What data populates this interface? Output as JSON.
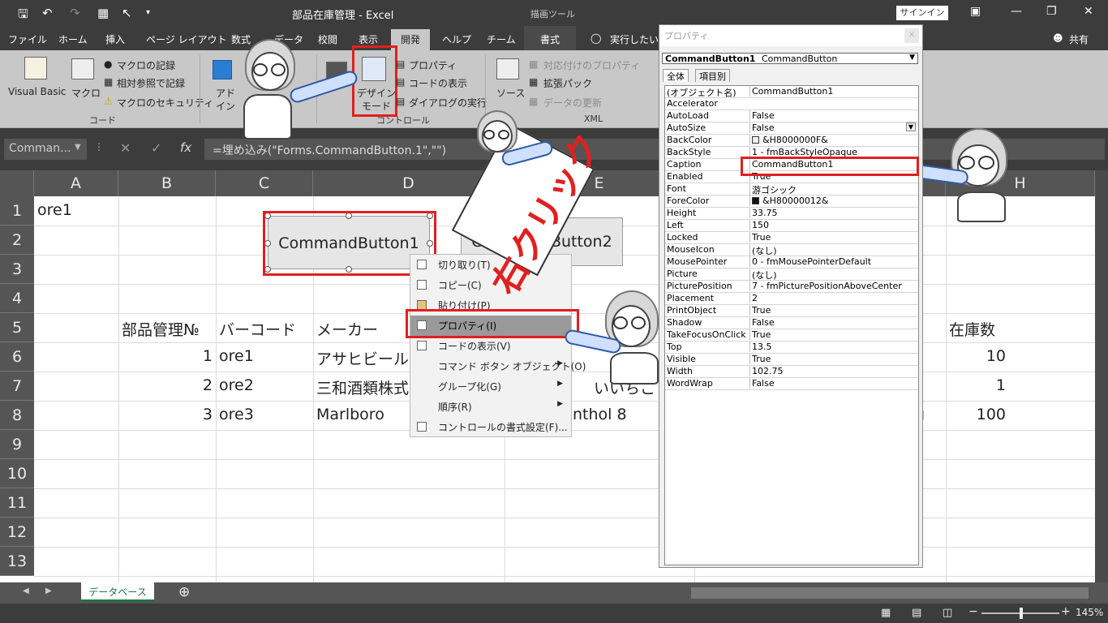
{
  "window": {
    "title": "部品在庫管理 - Excel",
    "drawing_tools": "描画ツール",
    "signin": "サインイン"
  },
  "tabs": [
    "ファイル",
    "ホーム",
    "挿入",
    "ページ レイアウト",
    "数式",
    "データ",
    "校閲",
    "表示",
    "開発",
    "ヘルプ",
    "チーム",
    "書式",
    "実行したい作業を入力してください",
    "共有"
  ],
  "ribbon": {
    "visual_basic": "Visual Basic",
    "macro": "マクロ",
    "macro_record": "マクロの記録",
    "relative_ref": "相対参照で記録",
    "macro_security": "マクロのセキュリティ",
    "group_code": "コード",
    "addin_line1": "アド",
    "addin_line2": "イン",
    "design_mode_line1": "デザイン",
    "design_mode_line2": "モード",
    "properties": "プロパティ",
    "view_code": "コードの表示",
    "run_dialog": "ダイアログの実行",
    "group_controls": "コントロール",
    "source": "ソース",
    "map_properties": "対応付けのプロパティ",
    "expansion_packs": "拡張パック",
    "refresh_data": "データの更新",
    "group_xml": "XML"
  },
  "formula_bar": {
    "name_box": "Comman...",
    "formula": "=埋め込み(\"Forms.CommandButton.1\",\"\")"
  },
  "sheet": {
    "columns": [
      "A",
      "B",
      "C",
      "D",
      "E",
      "H"
    ],
    "rows": [
      "1",
      "2",
      "3",
      "4",
      "5",
      "6",
      "7",
      "8",
      "9",
      "10",
      "11",
      "12",
      "13"
    ],
    "cells": {
      "a1": "ore1",
      "b5": "部品管理№",
      "c5": "バーコード",
      "d5": "メーカー",
      "h5": "在庫数",
      "b6": "1",
      "c6": "ore1",
      "d6": "アサヒビール",
      "h6": "10",
      "b7": "2",
      "c7": "ore2",
      "d7": "三和酒類株式",
      "e7": "いいちこ",
      "h7": "1",
      "b8": "3",
      "c8": "ore3",
      "d8": "Marlboro",
      "e8": "nthol 8",
      "g8": "g",
      "h8": "100"
    },
    "button1": "CommandButton1",
    "button2": "CommandButton2",
    "sheet_tab": "データベース"
  },
  "context_menu": {
    "items": [
      "切り取り(T)",
      "コピー(C)",
      "貼り付け(P)",
      "プロパティ(I)",
      "コードの表示(V)",
      "コマンド ボタン オブジェクト(O)",
      "グループ化(G)",
      "順序(R)",
      "コントロールの書式設定(F)..."
    ]
  },
  "annotation": "右クリック",
  "properties": {
    "title": "プロパティ",
    "object_name": "CommandButton1",
    "object_type": "CommandButton",
    "tab_all": "全体",
    "tab_categorized": "項目別",
    "rows": [
      [
        "(オブジェクト名)",
        "CommandButton1"
      ],
      [
        "Accelerator",
        ""
      ],
      [
        "AutoLoad",
        "False"
      ],
      [
        "AutoSize",
        "False"
      ],
      [
        "BackColor",
        "&H8000000F&"
      ],
      [
        "BackStyle",
        "1 - fmBackStyleOpaque"
      ],
      [
        "Caption",
        "CommandButton1"
      ],
      [
        "Enabled",
        "True"
      ],
      [
        "Font",
        "游ゴシック"
      ],
      [
        "ForeColor",
        "&H80000012&"
      ],
      [
        "Height",
        "33.75"
      ],
      [
        "Left",
        "150"
      ],
      [
        "Locked",
        "True"
      ],
      [
        "MouseIcon",
        "(なし)"
      ],
      [
        "MousePointer",
        "0 - fmMousePointerDefault"
      ],
      [
        "Picture",
        "(なし)"
      ],
      [
        "PicturePosition",
        "7 - fmPicturePositionAboveCenter"
      ],
      [
        "Placement",
        "2"
      ],
      [
        "PrintObject",
        "True"
      ],
      [
        "Shadow",
        "False"
      ],
      [
        "TakeFocusOnClick",
        "True"
      ],
      [
        "Top",
        "13.5"
      ],
      [
        "Visible",
        "True"
      ],
      [
        "Width",
        "102.75"
      ],
      [
        "WordWrap",
        "False"
      ]
    ]
  },
  "status": {
    "zoom": "145%"
  },
  "colors": {
    "highlight_red": "#e02020",
    "excel_green": "#217346"
  }
}
